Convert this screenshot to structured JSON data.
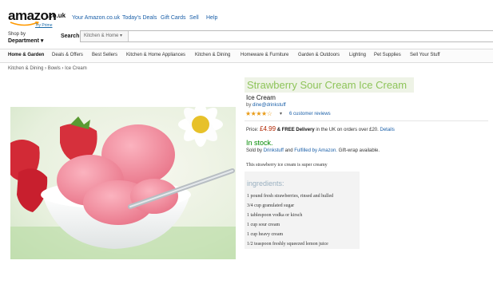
{
  "header": {
    "logo": {
      "word": "amazon",
      "domain": ".co.uk",
      "prime": "Try Prime"
    },
    "links": [
      "Your Amazon.co.uk",
      "Today's Deals",
      "Gift Cards",
      "Sell",
      "Help"
    ]
  },
  "search": {
    "shop_by_line1": "Shop by",
    "shop_by_line2": "Department",
    "label": "Search",
    "category": "Kitchen & Home"
  },
  "nav": {
    "items": [
      "Home & Garden",
      "Deals & Offers",
      "Best Sellers",
      "Kitchen & Home Appliances",
      "Kitchen & Dining",
      "Homeware & Furniture",
      "Garden & Outdoors",
      "Lighting",
      "Pet Supplies",
      "Sell Your Stuff"
    ]
  },
  "breadcrumb": {
    "items": [
      "Kitchen & Dining",
      "Bowls",
      "Ice Cream"
    ],
    "separator": "›"
  },
  "product": {
    "title": "Strawberry Sour Cream Ice Cream",
    "subtitle": "Ice Cream",
    "by_prefix": "by",
    "author": "dine@drinkstuff",
    "stars": "★★★★☆",
    "rating": 4,
    "reviews": "6 customer reviews",
    "price_label": "Price:",
    "price": "£4.99",
    "delivery_bold": "& FREE Delivery",
    "delivery_rest": "in the UK on orders over £20.",
    "details": "Details",
    "stock": "In stock.",
    "sold_by_prefix": "Sold by",
    "seller": "Drinkstuff",
    "and": "and",
    "fulfilled": "Fulfilled by Amazon.",
    "gift": "Gift-wrap available.",
    "description": "This strawberry ice cream is super creamy",
    "ingredients_title": "ingredients:",
    "ingredients": [
      "1 pound fresh strawberries, rinsed and hulled",
      "3/4 cup granulated sugar",
      "1 tablespoon vodka or kirsch",
      "1 cup sour cream",
      "1 cup heavy cream",
      "1/2 teaspoon freshly squeezed lemon juice"
    ]
  },
  "colors": {
    "title_green": "#8ec45a",
    "link_blue": "#1a5fa8",
    "price_red": "#b12704",
    "stock_green": "#008a00",
    "star_orange": "#e99b17"
  }
}
